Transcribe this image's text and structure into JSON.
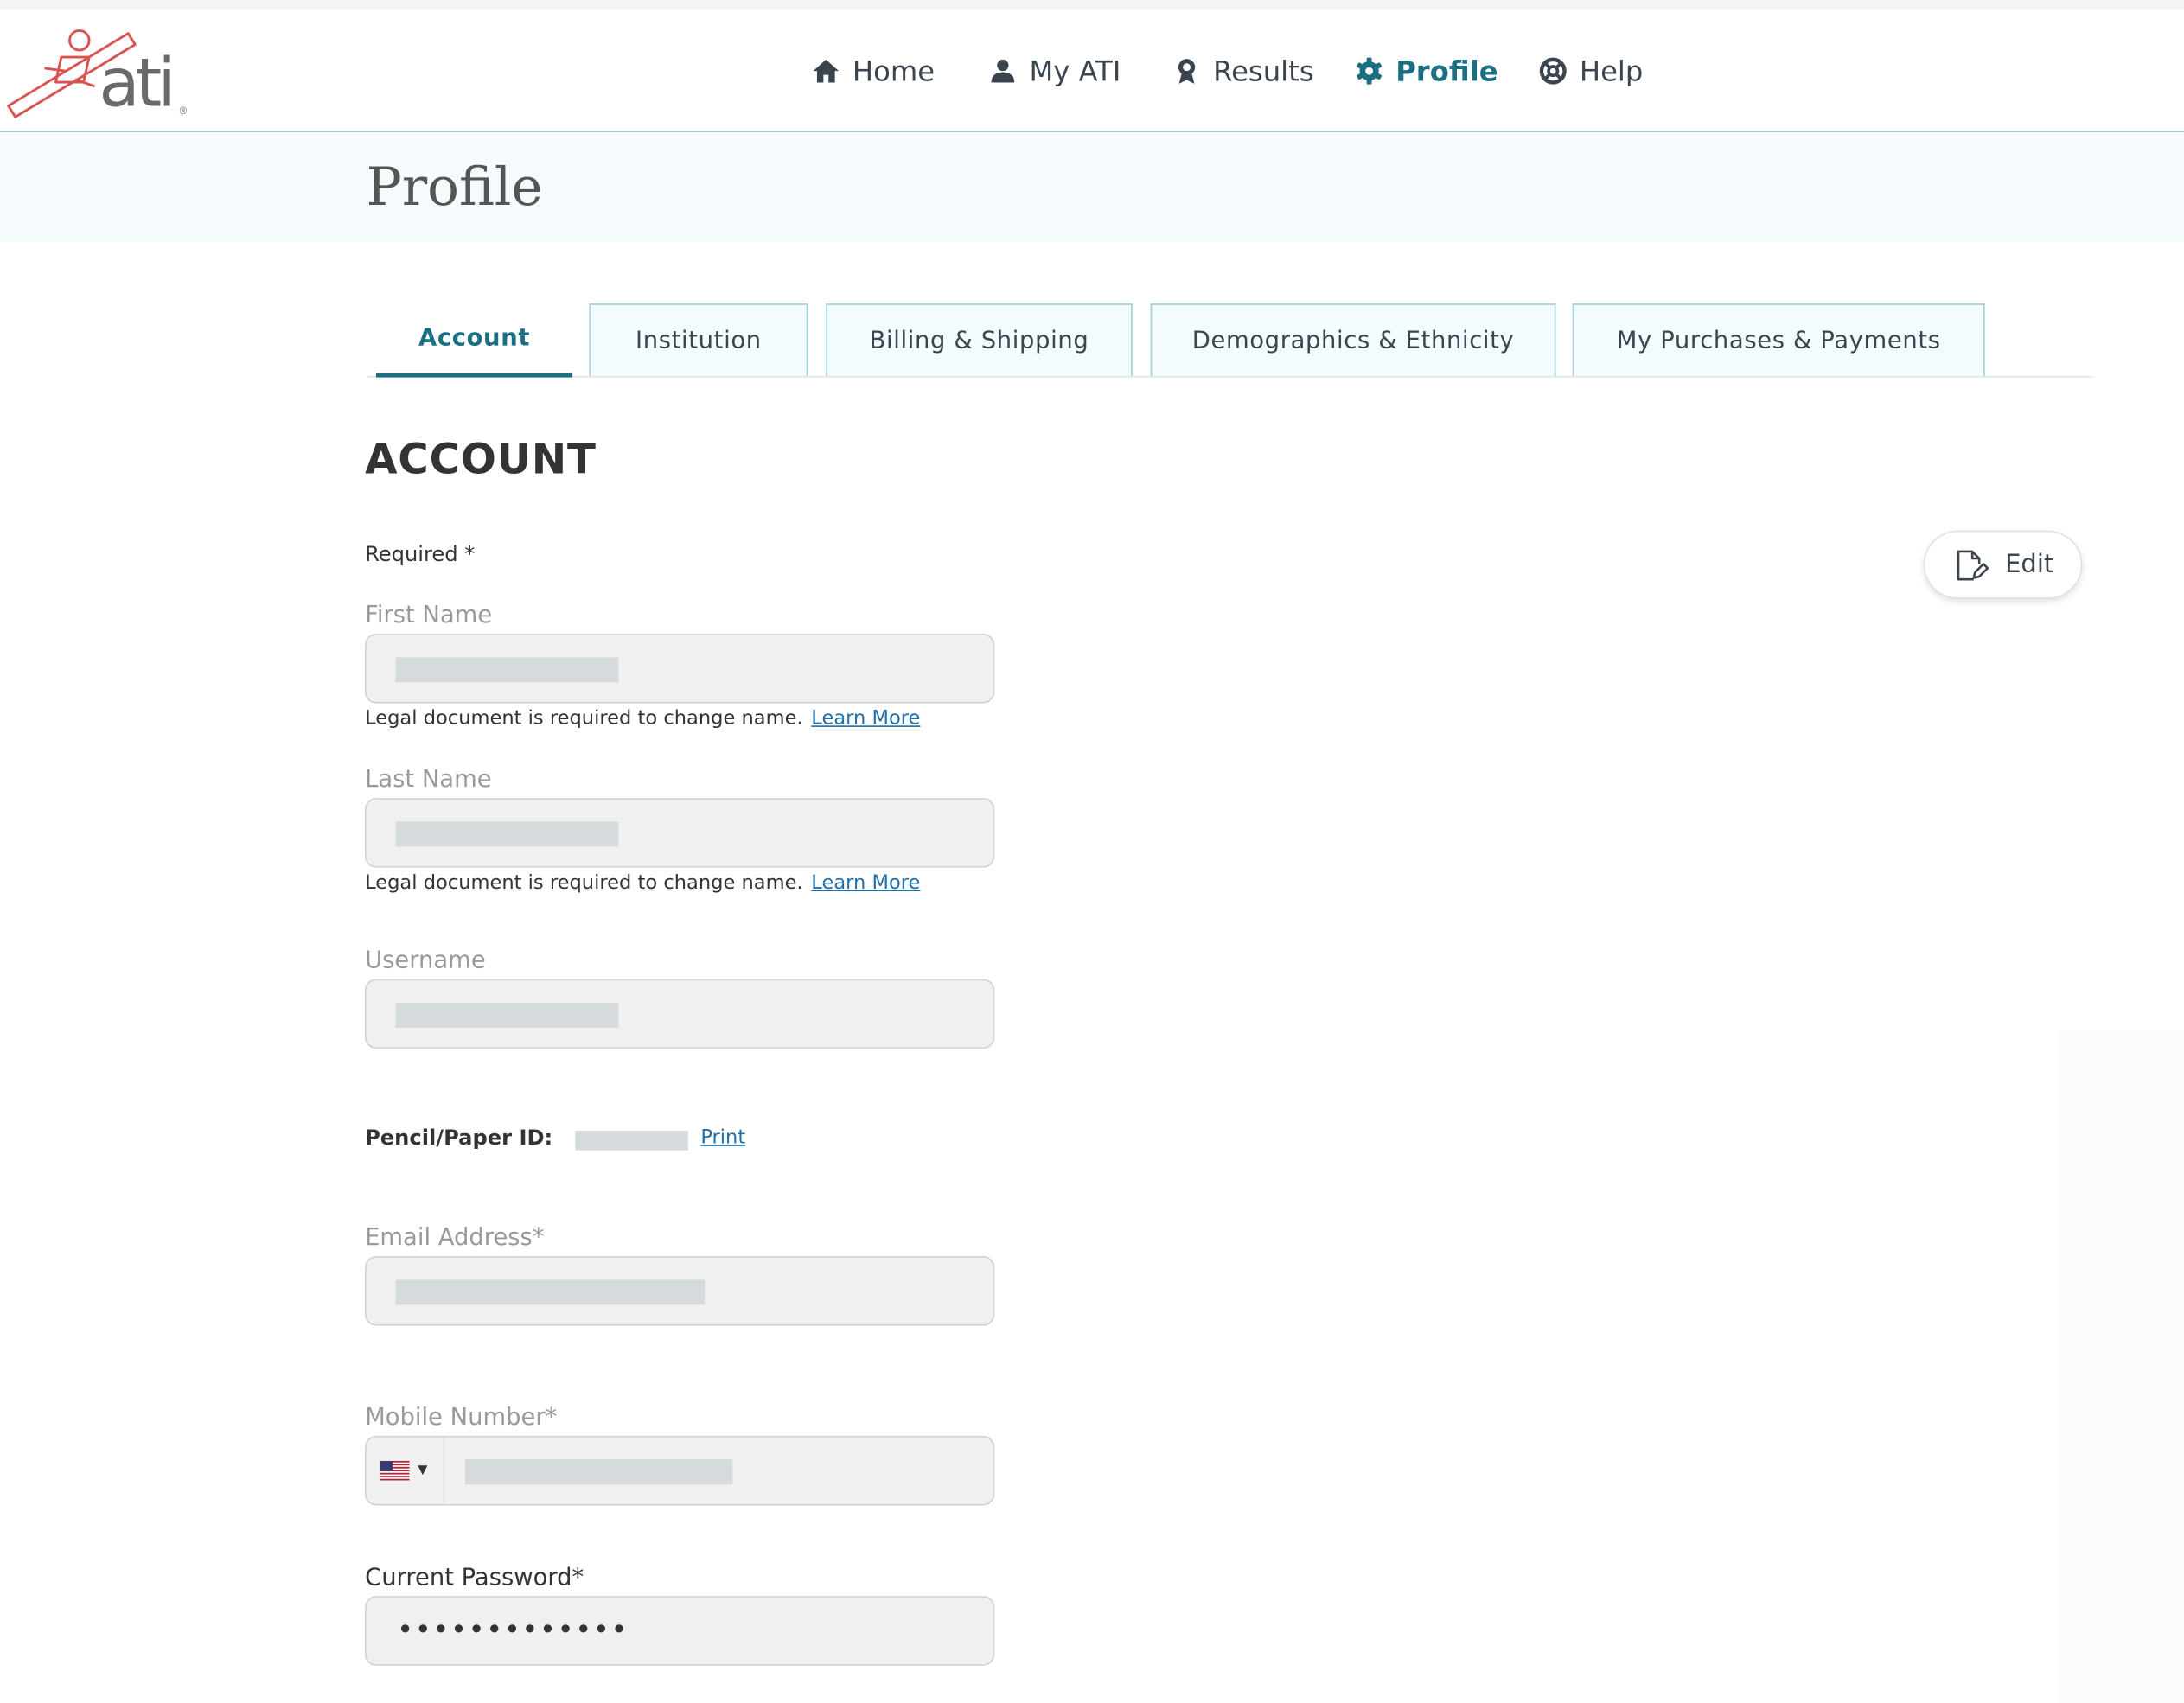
{
  "brand": {
    "logo_text": "ati",
    "logo_reg": "®",
    "primary_color": "#1b6f80",
    "logo_color": "#d9534f"
  },
  "nav": {
    "items": [
      {
        "label": "Home",
        "icon": "home-icon"
      },
      {
        "label": "My ATI",
        "icon": "person-icon"
      },
      {
        "label": "Results",
        "icon": "award-icon"
      },
      {
        "label": "Profile",
        "icon": "gear-icon",
        "active": true
      },
      {
        "label": "Help",
        "icon": "lifebuoy-icon"
      }
    ]
  },
  "page": {
    "title": "Profile"
  },
  "tabs": [
    {
      "label": "Account",
      "active": true
    },
    {
      "label": "Institution"
    },
    {
      "label": "Billing & Shipping"
    },
    {
      "label": "Demographics & Ethnicity"
    },
    {
      "label": "My Purchases & Payments"
    }
  ],
  "account": {
    "section_title": "ACCOUNT",
    "required_note": "Required *",
    "edit_label": "Edit",
    "first_name": {
      "label": "First Name",
      "help": "Legal document is required to change name.",
      "link": "Learn More"
    },
    "last_name": {
      "label": "Last Name",
      "help": "Legal document is required to change name.",
      "link": "Learn More"
    },
    "username": {
      "label": "Username"
    },
    "pencil_paper": {
      "label": "Pencil/Paper ID:",
      "print_link": "Print"
    },
    "email": {
      "label": "Email Address*"
    },
    "mobile": {
      "label": "Mobile Number*",
      "country_flag": "us-flag-icon"
    },
    "password": {
      "label": "Current Password*",
      "masked_value": "•••••••••••••"
    }
  }
}
